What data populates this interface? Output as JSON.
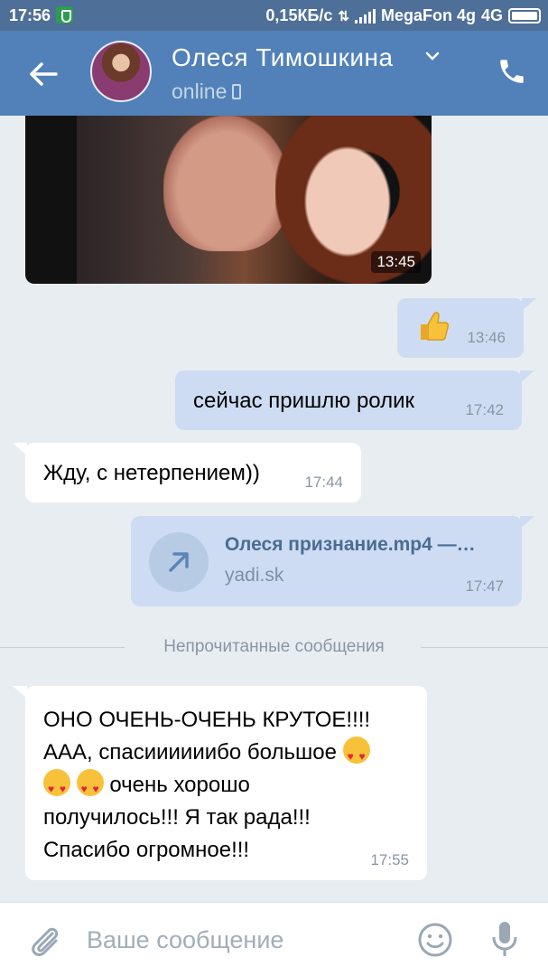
{
  "statusbar": {
    "time": "17:56",
    "speed": "0,15КБ/с",
    "carrier": "MegaFon 4g",
    "network": "4G"
  },
  "header": {
    "name": "Олеся Тимошкина",
    "status": "online"
  },
  "messages": [
    {
      "time": "13:45"
    },
    {
      "time": "13:46",
      "emoji": "thumbs-up"
    },
    {
      "text": "сейчас пришлю ролик",
      "time": "17:42"
    },
    {
      "text": "Жду, с нетерпением))",
      "time": "17:44"
    },
    {
      "file_name": "Олеся признание.mp4 —…",
      "host": "yadi.sk",
      "time": "17:47"
    }
  ],
  "divider": {
    "label": "Непрочитанные сообщения"
  },
  "last_message": {
    "line1": "ОНО ОЧЕНЬ-ОЧЕНЬ КРУТОЕ!!!!",
    "line2": "ААА, спасиииииибо большое",
    "line3": " очень хорошо",
    "line4": "получилось!!! Я так рада!!!",
    "line5": "Спасибо огромное!!!",
    "time": "17:55"
  },
  "composer": {
    "placeholder": "Ваше сообщение"
  },
  "colors": {
    "header": "#5181b8",
    "statusbar": "#4e6f98",
    "outgoing": "#cddcf2",
    "incoming": "#ffffff",
    "background": "#e8edf2"
  }
}
